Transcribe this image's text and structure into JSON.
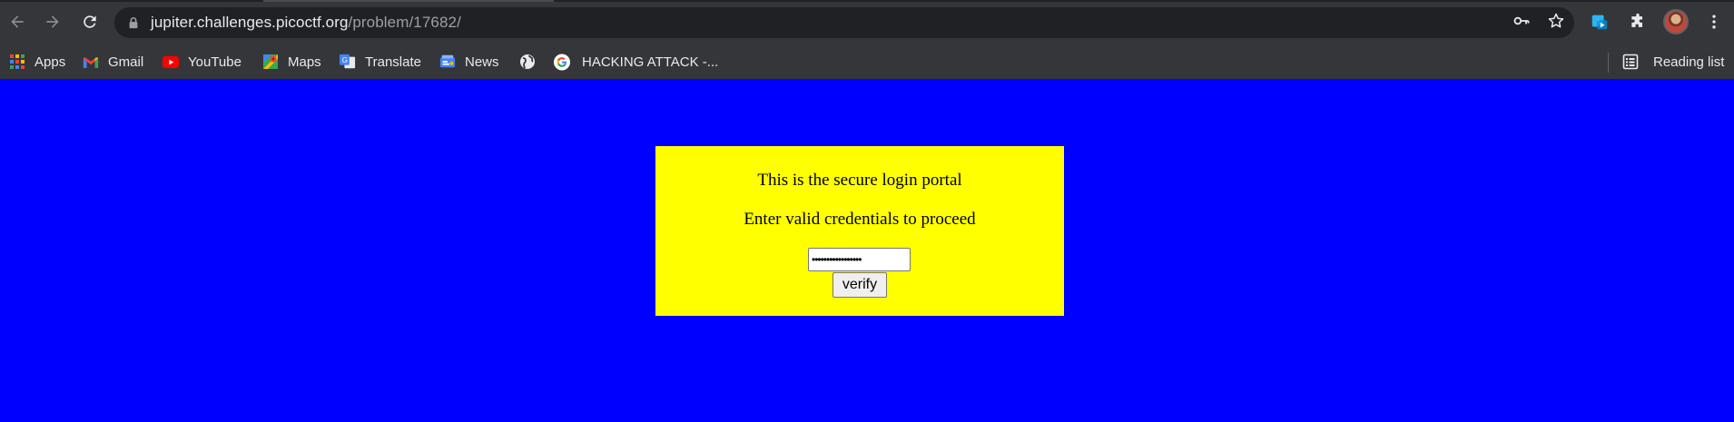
{
  "browser": {
    "url_host": "jupiter.challenges.picoctf.org",
    "url_path": "/problem/17682/",
    "colors": {
      "toolbar": "#35363a",
      "omnibox": "#202124",
      "text": "#e8eaed"
    },
    "icons": {
      "back": "arrow-left-icon",
      "forward": "arrow-right-icon",
      "reload": "reload-icon",
      "lock": "lock-icon",
      "key": "key-icon",
      "bookmark_star": "star-icon",
      "extension_1": "extension-app-icon",
      "extensions": "puzzle-icon",
      "profile": "avatar",
      "menu": "more-vert-icon"
    }
  },
  "bookmarks": {
    "items": [
      {
        "label": "Apps",
        "icon": "apps-grid-icon"
      },
      {
        "label": "Gmail",
        "icon": "gmail-icon"
      },
      {
        "label": "YouTube",
        "icon": "youtube-icon"
      },
      {
        "label": "Maps",
        "icon": "maps-icon"
      },
      {
        "label": "Translate",
        "icon": "translate-icon"
      },
      {
        "label": "News",
        "icon": "news-icon"
      },
      {
        "label": "",
        "icon": "globe-icon"
      },
      {
        "label": "HACKING ATTACK -...",
        "icon": "google-icon"
      }
    ],
    "reading_list": {
      "label": "Reading list",
      "icon": "reading-list-icon"
    }
  },
  "page": {
    "background": "#0000ff",
    "panel_color": "#ffff00",
    "heading": "This is the secure login portal",
    "instruction": "Enter valid credentials to proceed",
    "password_value": "•••••••••••••••••",
    "verify_label": "verify"
  }
}
